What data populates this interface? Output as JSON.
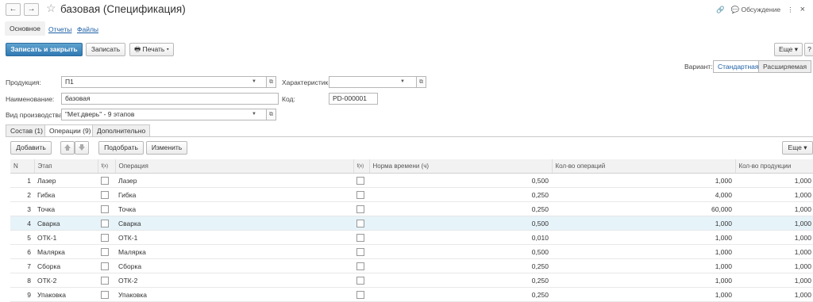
{
  "header": {
    "back": "←",
    "forward": "→",
    "title": "базовая (Спецификация)",
    "discussion": "Обсуждение",
    "more": "⋮",
    "close": "×"
  },
  "nav_tabs": {
    "main": "Основное",
    "reports": "Отчеты",
    "files": "Файлы"
  },
  "toolbar": {
    "save_close": "Записать и закрыть",
    "save": "Записать",
    "print": "Печать",
    "more": "Еще",
    "help": "?"
  },
  "variant": {
    "label": "Вариант:",
    "standard": "Стандартная",
    "extended": "Расширяемая"
  },
  "form": {
    "product_label": "Продукция:",
    "product_value": "П1",
    "characteristic_label": "Характеристика:",
    "characteristic_value": "",
    "name_label": "Наименование:",
    "name_value": "базовая",
    "code_label": "Код:",
    "code_value": "PD-000001",
    "prod_type_label": "Вид производства:",
    "prod_type_value": "\"Мет.дверь\" - 9 этапов"
  },
  "doc_tabs": {
    "composition": "Состав (1)",
    "operations": "Операции (9)",
    "additional": "Дополнительно"
  },
  "table_toolbar": {
    "add": "Добавить",
    "pick": "Подобрать",
    "change": "Изменить",
    "more": "Еще"
  },
  "table": {
    "headers": {
      "n": "N",
      "stage": "Этап",
      "fx1": "f(x)",
      "operation": "Операция",
      "fx2": "f(x)",
      "time_norm": "Норма времени (ч)",
      "ops_count": "Кол-во операций",
      "prod_count": "Кол-во продукции"
    },
    "rows": [
      {
        "n": "1",
        "stage": "Лазер",
        "op": "Лазер",
        "time": "0,500",
        "ops": "1,000",
        "prod": "1,000"
      },
      {
        "n": "2",
        "stage": "Гибка",
        "op": "Гибка",
        "time": "0,250",
        "ops": "4,000",
        "prod": "1,000"
      },
      {
        "n": "3",
        "stage": "Точка",
        "op": "Точка",
        "time": "0,250",
        "ops": "60,000",
        "prod": "1,000"
      },
      {
        "n": "4",
        "stage": "Сварка",
        "op": "Сварка",
        "time": "0,500",
        "ops": "1,000",
        "prod": "1,000"
      },
      {
        "n": "5",
        "stage": "ОТК-1",
        "op": "ОТК-1",
        "time": "0,010",
        "ops": "1,000",
        "prod": "1,000"
      },
      {
        "n": "6",
        "stage": "Малярка",
        "op": "Малярка",
        "time": "0,500",
        "ops": "1,000",
        "prod": "1,000"
      },
      {
        "n": "7",
        "stage": "Сборка",
        "op": "Сборка",
        "time": "0,250",
        "ops": "1,000",
        "prod": "1,000"
      },
      {
        "n": "8",
        "stage": "ОТК-2",
        "op": "ОТК-2",
        "time": "0,250",
        "ops": "1,000",
        "prod": "1,000"
      },
      {
        "n": "9",
        "stage": "Упаковка",
        "op": "Упаковка",
        "time": "0,250",
        "ops": "1,000",
        "prod": "1,000"
      }
    ]
  }
}
